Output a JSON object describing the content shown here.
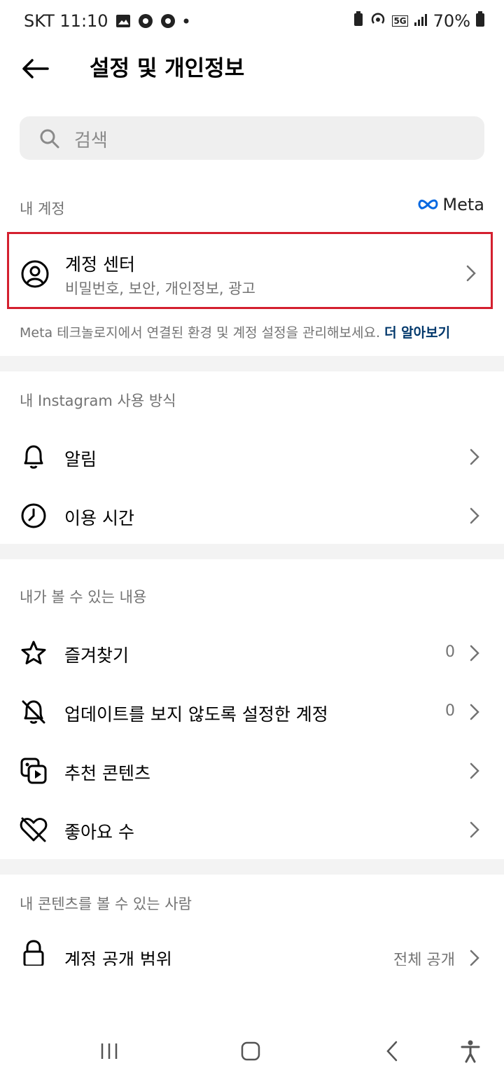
{
  "status_bar": {
    "carrier_time": "SKT 11:10",
    "network": "5G",
    "battery": "70%"
  },
  "header": {
    "title": "설정 및 개인정보",
    "back_icon": "arrow-left-icon"
  },
  "search": {
    "placeholder": "검색",
    "icon": "search-icon"
  },
  "my_account": {
    "label": "내 계정",
    "meta_logo": "Meta",
    "account_center": {
      "title": "계정 센터",
      "subtitle": "비밀번호, 보안, 개인정보, 광고",
      "icon": "user-circle-icon"
    },
    "note": "Meta 테크놀로지에서 연결된 환경 및 계정 설정을 관리해보세요.",
    "learn_more": "더 알아보기"
  },
  "usage": {
    "label": "내 Instagram 사용 방식",
    "items": [
      {
        "label": "알림",
        "icon": "bell-icon"
      },
      {
        "label": "이용 시간",
        "icon": "clock-icon"
      }
    ]
  },
  "visible_content": {
    "label": "내가 볼 수 있는 내용",
    "items": [
      {
        "label": "즐겨찾기",
        "count": "0",
        "icon": "star-icon"
      },
      {
        "label": "업데이트를 보지 않도록 설정한 계정",
        "count": "0",
        "icon": "bell-off-icon"
      },
      {
        "label": "추천 콘텐츠",
        "icon": "suggested-media-icon"
      },
      {
        "label": "좋아요 수",
        "icon": "heart-off-icon"
      }
    ]
  },
  "who_sees": {
    "label": "내 콘텐츠를 볼 수 있는 사람",
    "items": [
      {
        "label": "계정 공개 범위",
        "value": "전체 공개",
        "icon": "lock-icon"
      }
    ]
  },
  "nav": {
    "recents_icon": "recents-icon",
    "home_icon": "home-icon",
    "back_icon": "back-icon",
    "accessibility_icon": "accessibility-icon"
  }
}
